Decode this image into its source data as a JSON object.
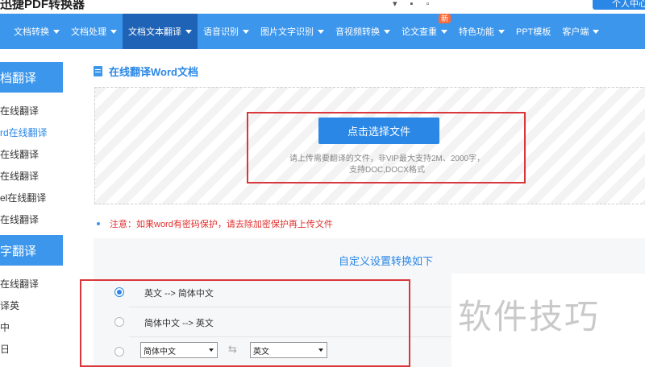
{
  "topbar": {
    "logo_text": "迅捷PDF转换器",
    "user_button": "个人中心"
  },
  "nav": {
    "items": [
      {
        "label": "文档转换",
        "caret": true
      },
      {
        "label": "文档处理",
        "caret": true
      },
      {
        "label": "文档文本翻译",
        "caret": true,
        "active": true
      },
      {
        "label": "语音识别",
        "caret": true
      },
      {
        "label": "图片文字识别",
        "caret": true
      },
      {
        "label": "音视频转换",
        "caret": true
      },
      {
        "label": "论文查重",
        "caret": true,
        "badge": "新"
      },
      {
        "label": "特色功能",
        "caret": true
      },
      {
        "label": "PPT模板",
        "caret": false
      },
      {
        "label": "客户端",
        "caret": true
      }
    ]
  },
  "sidebar": {
    "section1_head": "档翻译",
    "section1_items": [
      "在线翻译",
      "rd在线翻译",
      "在线翻译",
      "在线翻译",
      "el在线翻译",
      "在线翻译"
    ],
    "section2_head": "字翻译",
    "section2_items": [
      "在线翻译",
      "译英",
      "中",
      "日"
    ]
  },
  "main": {
    "title": "在线翻译Word文档",
    "choose_button": "点击选择文件",
    "upload_hint_line1": "请上传需要翻译的文件，非VIP最大支持2M、2000字，",
    "upload_hint_line2": "支持DOC,DOCX格式",
    "notice": "注意：如果word有密码保护，请去除加密保护再上传文件",
    "settings_title": "自定义设置转换如下",
    "options": [
      {
        "label": "英文 --> 简体中文",
        "checked": true
      },
      {
        "label": "简体中文 --> 英文",
        "checked": false
      }
    ],
    "source_lang": "简体中文",
    "target_lang": "英文"
  },
  "watermark": "软件技巧",
  "colors": {
    "nav_bg": "#3b96ec",
    "nav_active": "#1f63b6",
    "accent": "#2a87e6",
    "highlight_box": "#d9373b",
    "notice": "#e0302e"
  }
}
